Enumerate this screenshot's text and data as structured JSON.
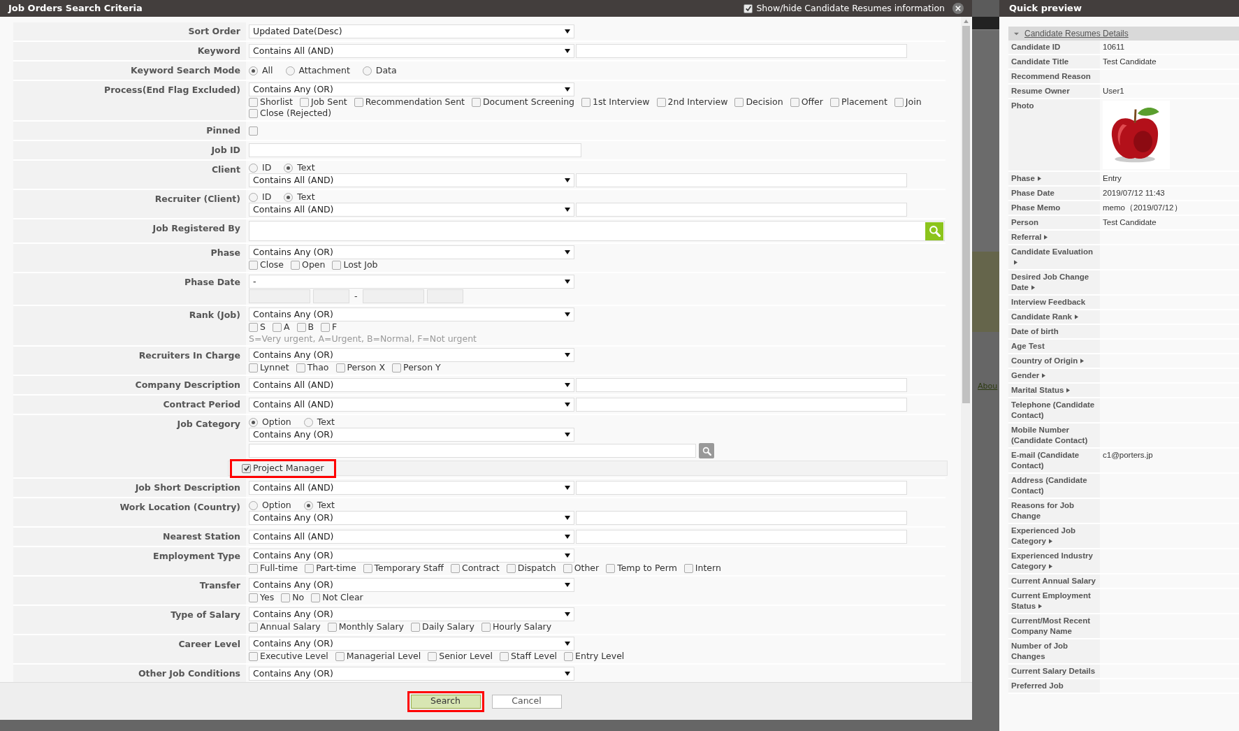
{
  "dialog": {
    "title": "Job Orders Search Criteria",
    "toggle": {
      "label": "Show/hide Candidate Resumes information",
      "checked": true
    }
  },
  "rows": [
    {
      "label": "Sort Order",
      "lines": [
        {
          "kind": "select",
          "value": "Updated Date(Desc)"
        }
      ]
    },
    {
      "label": "Keyword",
      "lines": [
        {
          "kind": "select_input",
          "value": "Contains All (AND)"
        }
      ]
    },
    {
      "label": "Keyword Search Mode",
      "lines": [
        {
          "kind": "radios",
          "options": [
            {
              "label": "All",
              "selected": true
            },
            {
              "label": "Attachment",
              "selected": false
            },
            {
              "label": "Data",
              "selected": false
            }
          ]
        }
      ]
    },
    {
      "label": "Process(End Flag Excluded)",
      "lines": [
        {
          "kind": "select",
          "value": "Contains Any (OR)"
        },
        {
          "kind": "checks",
          "options": [
            {
              "label": "Shorlist",
              "checked": false
            },
            {
              "label": "Job Sent",
              "checked": false
            },
            {
              "label": "Recommendation Sent",
              "checked": false
            },
            {
              "label": "Document Screening",
              "checked": false
            },
            {
              "label": "1st Interview",
              "checked": false
            },
            {
              "label": "2nd Interview",
              "checked": false
            },
            {
              "label": "Decision",
              "checked": false
            },
            {
              "label": "Offer",
              "checked": false
            },
            {
              "label": "Placement",
              "checked": false
            },
            {
              "label": "Join",
              "checked": false
            }
          ]
        },
        {
          "kind": "checks",
          "options": [
            {
              "label": "Close (Rejected)",
              "checked": false
            }
          ]
        }
      ]
    },
    {
      "label": "Pinned",
      "lines": [
        {
          "kind": "checkbox",
          "checked": false
        }
      ]
    },
    {
      "label": "Job ID",
      "lines": [
        {
          "kind": "input"
        }
      ]
    },
    {
      "label": "Client",
      "lines": [
        {
          "kind": "radios",
          "options": [
            {
              "label": "ID",
              "selected": false
            },
            {
              "label": "Text",
              "selected": true
            }
          ]
        },
        {
          "kind": "select_input",
          "value": "Contains All (AND)"
        }
      ]
    },
    {
      "label": "Recruiter (Client)",
      "lines": [
        {
          "kind": "radios",
          "options": [
            {
              "label": "ID",
              "selected": false
            },
            {
              "label": "Text",
              "selected": true
            }
          ]
        },
        {
          "kind": "select_input",
          "value": "Contains All (AND)"
        }
      ]
    },
    {
      "label": "Job Registered By",
      "lines": [
        {
          "kind": "lookup"
        }
      ]
    },
    {
      "label": "Phase",
      "lines": [
        {
          "kind": "select",
          "value": "Contains Any (OR)"
        },
        {
          "kind": "checks",
          "options": [
            {
              "label": "Close",
              "checked": false
            },
            {
              "label": "Open",
              "checked": false
            },
            {
              "label": "Lost Job",
              "checked": false
            }
          ]
        }
      ]
    },
    {
      "label": "Phase Date",
      "lines": [
        {
          "kind": "select",
          "value": "-"
        },
        {
          "kind": "dates",
          "separator": "-"
        }
      ]
    },
    {
      "label": "Rank (Job)",
      "lines": [
        {
          "kind": "select",
          "value": "Contains Any (OR)"
        },
        {
          "kind": "checks",
          "options": [
            {
              "label": "S",
              "checked": false
            },
            {
              "label": "A",
              "checked": false
            },
            {
              "label": "B",
              "checked": false
            },
            {
              "label": "F",
              "checked": false
            }
          ]
        },
        {
          "kind": "hint",
          "text": "S=Very urgent, A=Urgent, B=Normal, F=Not urgent"
        }
      ]
    },
    {
      "label": "Recruiters In Charge",
      "lines": [
        {
          "kind": "select",
          "value": "Contains Any (OR)"
        },
        {
          "kind": "checks",
          "options": [
            {
              "label": "Lynnet",
              "checked": false
            },
            {
              "label": "Thao",
              "checked": false
            },
            {
              "label": "Person X",
              "checked": false
            },
            {
              "label": "Person Y",
              "checked": false
            }
          ]
        }
      ]
    },
    {
      "label": "Company Description",
      "lines": [
        {
          "kind": "select_input",
          "value": "Contains All (AND)"
        }
      ]
    },
    {
      "label": "Contract Period",
      "lines": [
        {
          "kind": "select_input",
          "value": "Contains All (AND)"
        }
      ]
    },
    {
      "label": "Job Category",
      "lines": [
        {
          "kind": "radios",
          "options": [
            {
              "label": "Option",
              "selected": true
            },
            {
              "label": "Text",
              "selected": false
            }
          ]
        },
        {
          "kind": "select",
          "value": "Contains Any (OR)"
        },
        {
          "kind": "picker"
        },
        {
          "kind": "tag",
          "label": "Project Manager",
          "checked": true,
          "highlighted": true
        }
      ]
    },
    {
      "label": "Job Short Description",
      "lines": [
        {
          "kind": "select_input",
          "value": "Contains All (AND)"
        }
      ]
    },
    {
      "label": "Work Location (Country)",
      "lines": [
        {
          "kind": "radios",
          "options": [
            {
              "label": "Option",
              "selected": false
            },
            {
              "label": "Text",
              "selected": true
            }
          ]
        },
        {
          "kind": "select_input",
          "value": "Contains Any (OR)"
        }
      ]
    },
    {
      "label": "Nearest Station",
      "lines": [
        {
          "kind": "select_input",
          "value": "Contains All (AND)"
        }
      ]
    },
    {
      "label": "Employment Type",
      "lines": [
        {
          "kind": "select",
          "value": "Contains Any (OR)"
        },
        {
          "kind": "checks",
          "options": [
            {
              "label": "Full-time",
              "checked": false
            },
            {
              "label": "Part-time",
              "checked": false
            },
            {
              "label": "Temporary Staff",
              "checked": false
            },
            {
              "label": "Contract",
              "checked": false
            },
            {
              "label": "Dispatch",
              "checked": false
            },
            {
              "label": "Other",
              "checked": false
            },
            {
              "label": "Temp to Perm",
              "checked": false
            },
            {
              "label": "Intern",
              "checked": false
            }
          ]
        }
      ]
    },
    {
      "label": "Transfer",
      "lines": [
        {
          "kind": "select",
          "value": "Contains Any (OR)"
        },
        {
          "kind": "checks",
          "options": [
            {
              "label": "Yes",
              "checked": false
            },
            {
              "label": "No",
              "checked": false
            },
            {
              "label": "Not Clear",
              "checked": false
            }
          ]
        }
      ]
    },
    {
      "label": "Type of Salary",
      "lines": [
        {
          "kind": "select",
          "value": "Contains Any (OR)"
        },
        {
          "kind": "checks",
          "options": [
            {
              "label": "Annual Salary",
              "checked": false
            },
            {
              "label": "Monthly Salary",
              "checked": false
            },
            {
              "label": "Daily Salary",
              "checked": false
            },
            {
              "label": "Hourly Salary",
              "checked": false
            }
          ]
        }
      ]
    },
    {
      "label": "Career Level",
      "lines": [
        {
          "kind": "select",
          "value": "Contains Any (OR)"
        },
        {
          "kind": "checks",
          "options": [
            {
              "label": "Executive Level",
              "checked": false
            },
            {
              "label": "Managerial Level",
              "checked": false
            },
            {
              "label": "Senior Level",
              "checked": false
            },
            {
              "label": "Staff Level",
              "checked": false
            },
            {
              "label": "Entry Level",
              "checked": false
            }
          ]
        }
      ]
    },
    {
      "label": "Other Job Conditions",
      "lines": [
        {
          "kind": "select",
          "value": "Contains Any (OR)"
        }
      ]
    }
  ],
  "footer_buttons": [
    {
      "label": "Search",
      "kind": "primary",
      "highlighted": true
    },
    {
      "label": "Cancel",
      "kind": "secondary",
      "highlighted": false
    }
  ],
  "background_link": "Abou",
  "preview": {
    "title": "Quick preview",
    "section": {
      "title": "Candidate Resumes Details",
      "expanded": true
    },
    "fields": [
      {
        "label": "Candidate ID",
        "kind": "text",
        "arrow": false,
        "value": "10611"
      },
      {
        "label": "Candidate Title",
        "kind": "text",
        "arrow": false,
        "value": "Test Candidate"
      },
      {
        "label": "Recommend Reason",
        "kind": "text",
        "arrow": false
      },
      {
        "label": "Resume Owner",
        "kind": "text",
        "arrow": false,
        "value": "User1"
      },
      {
        "label": "Photo",
        "kind": "picture",
        "arrow": false
      },
      {
        "label": "Phase",
        "kind": "text",
        "arrow": true,
        "value": "Entry"
      },
      {
        "label": "Phase Date",
        "kind": "text",
        "arrow": false,
        "value": "2019/07/12 11:43"
      },
      {
        "label": "Phase Memo",
        "kind": "text",
        "arrow": false,
        "value": "memo（2019/07/12）"
      },
      {
        "label": "Person",
        "kind": "text",
        "arrow": false,
        "value": "Test Candidate"
      },
      {
        "label": "Referral",
        "kind": "text",
        "arrow": true
      },
      {
        "label": "Candidate Evaluation",
        "kind": "text",
        "arrow": true
      },
      {
        "label": "Desired Job Change Date",
        "kind": "text",
        "arrow": true
      },
      {
        "label": "Interview Feedback",
        "kind": "text",
        "arrow": false
      },
      {
        "label": "Candidate Rank",
        "kind": "text",
        "arrow": true
      },
      {
        "label": "Date of birth",
        "kind": "text",
        "arrow": false
      },
      {
        "label": "Age Test",
        "kind": "text",
        "arrow": false
      },
      {
        "label": "Country of Origin",
        "kind": "text",
        "arrow": true
      },
      {
        "label": "Gender",
        "kind": "text",
        "arrow": true
      },
      {
        "label": "Marital Status",
        "kind": "text",
        "arrow": true
      },
      {
        "label": "Telephone (Candidate Contact)",
        "kind": "text",
        "arrow": false
      },
      {
        "label": "Mobile Number (Candidate Contact)",
        "kind": "text",
        "arrow": false
      },
      {
        "label": "E-mail (Candidate Contact)",
        "kind": "text",
        "arrow": false,
        "value": "c1@porters.jp"
      },
      {
        "label": "Address (Candidate Contact)",
        "kind": "text",
        "arrow": false
      },
      {
        "label": "Reasons for Job Change",
        "kind": "text",
        "arrow": false
      },
      {
        "label": "Experienced Job Category",
        "kind": "text",
        "arrow": true
      },
      {
        "label": "Experienced Industry Category",
        "kind": "text",
        "arrow": true
      },
      {
        "label": "Current Annual Salary",
        "kind": "text",
        "arrow": false
      },
      {
        "label": "Current Employment Status",
        "kind": "text",
        "arrow": true
      },
      {
        "label": "Current/Most Recent Company Name",
        "kind": "text",
        "arrow": false
      },
      {
        "label": "Number of Job Changes",
        "kind": "text",
        "arrow": false
      },
      {
        "label": "Current Salary Details",
        "kind": "text",
        "arrow": false
      },
      {
        "label": "Preferred Job",
        "kind": "text",
        "arrow": false
      }
    ]
  }
}
